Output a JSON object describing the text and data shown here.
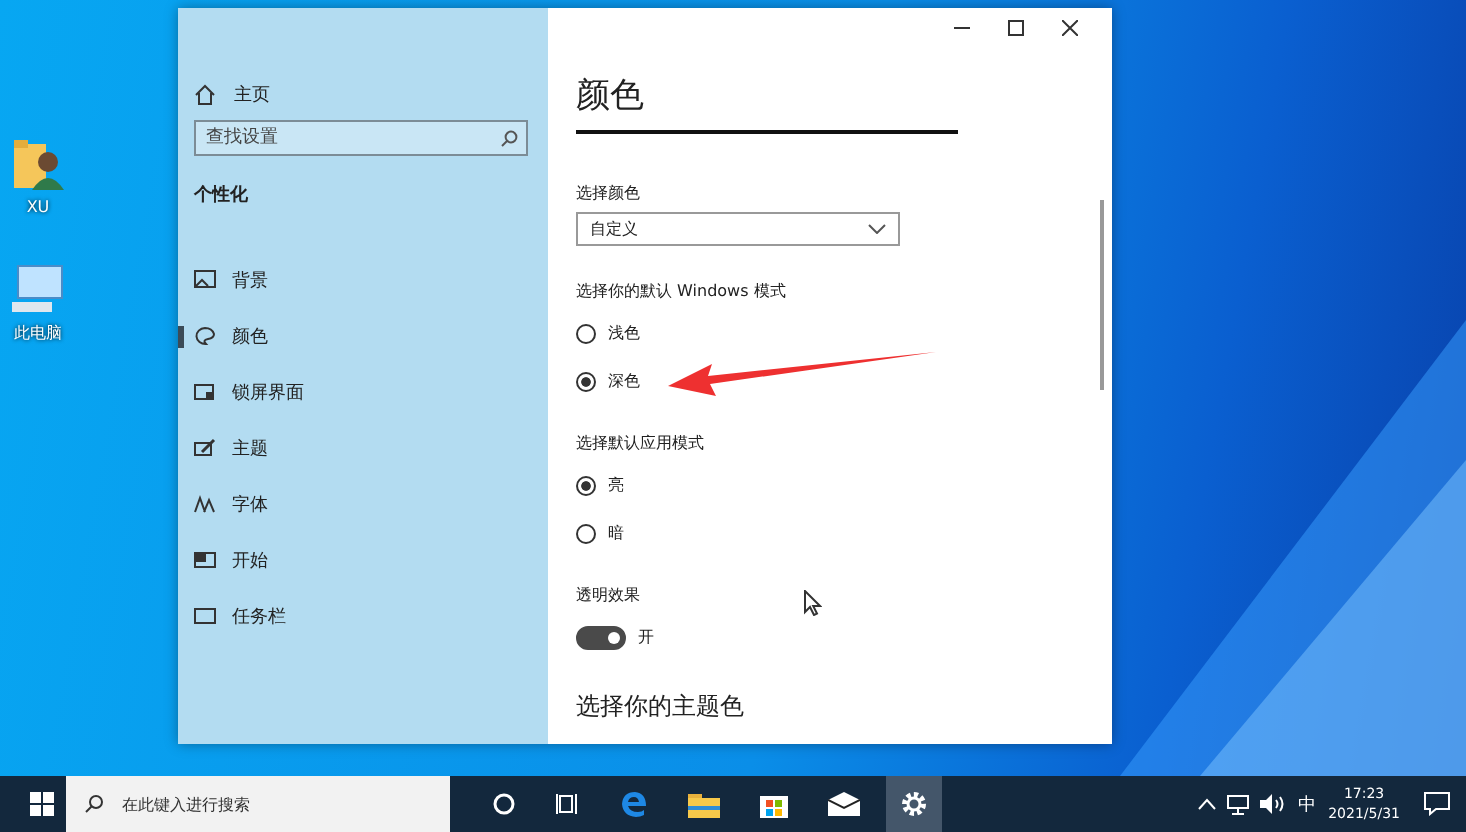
{
  "desktop_icons": [
    {
      "kind": "user-folder",
      "label": "XU"
    },
    {
      "kind": "computer",
      "label": "此电脑"
    }
  ],
  "sidebar": {
    "home": "主页",
    "search_placeholder": "查找设置",
    "section": "个性化",
    "items": [
      {
        "kind": "background",
        "label": "背景",
        "selected": false
      },
      {
        "kind": "color",
        "label": "颜色",
        "selected": true
      },
      {
        "kind": "lockscreen",
        "label": "锁屏界面",
        "selected": false
      },
      {
        "kind": "theme",
        "label": "主题",
        "selected": false
      },
      {
        "kind": "font",
        "label": "字体",
        "selected": false
      },
      {
        "kind": "start",
        "label": "开始",
        "selected": false
      },
      {
        "kind": "taskbar",
        "label": "任务栏",
        "selected": false
      }
    ]
  },
  "content": {
    "title": "颜色",
    "color_label": "选择颜色",
    "color_value": "自定义",
    "groups": [
      {
        "label": "选择你的默认 Windows 模式",
        "options": [
          {
            "label": "浅色",
            "selected": false
          },
          {
            "label": "深色",
            "selected": true
          }
        ]
      },
      {
        "label": "选择默认应用模式",
        "options": [
          {
            "label": "亮",
            "selected": true
          },
          {
            "label": "暗",
            "selected": false
          }
        ]
      }
    ],
    "transparency": {
      "label": "透明效果",
      "on": true,
      "state_text": "开"
    },
    "accent_heading": "选择你的主题色"
  },
  "taskbar": {
    "search_placeholder": "在此键入进行搜索",
    "ime": "中",
    "time": "17:23",
    "date": "2021/5/31"
  }
}
